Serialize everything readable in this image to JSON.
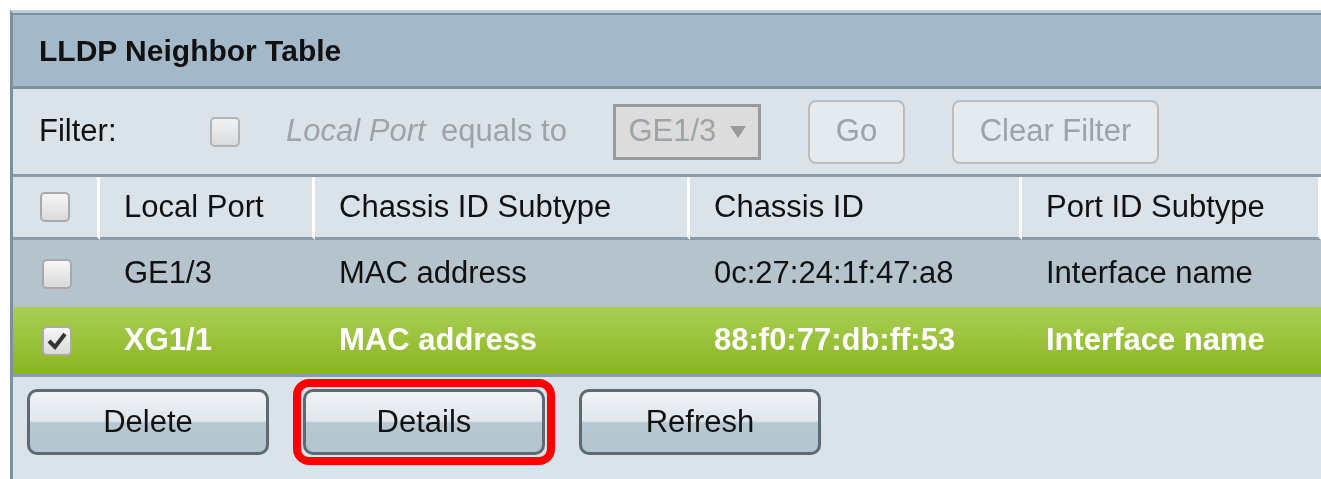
{
  "panel": {
    "title": "LLDP Neighbor Table"
  },
  "filter": {
    "label": "Filter:",
    "checked": false,
    "field_name": "Local Port",
    "condition": "equals to",
    "value": "GE1/3",
    "disabled": true,
    "buttons": [
      "Go",
      "Clear Filter"
    ]
  },
  "table": {
    "header_checked": false,
    "columns": [
      "Local Port",
      "Chassis ID Subtype",
      "Chassis ID",
      "Port ID Subtype"
    ],
    "rows": [
      {
        "selected": false,
        "cells": [
          "GE1/3",
          "MAC address",
          "0c:27:24:1f:47:a8",
          "Interface name"
        ]
      },
      {
        "selected": true,
        "cells": [
          "XG1/1",
          "MAC address",
          "88:f0:77:db:ff:53",
          "Interface name"
        ]
      }
    ]
  },
  "actions": [
    {
      "label": "Delete",
      "highlighted": false
    },
    {
      "label": "Details",
      "highlighted": true
    },
    {
      "label": "Refresh",
      "highlighted": false
    }
  ]
}
